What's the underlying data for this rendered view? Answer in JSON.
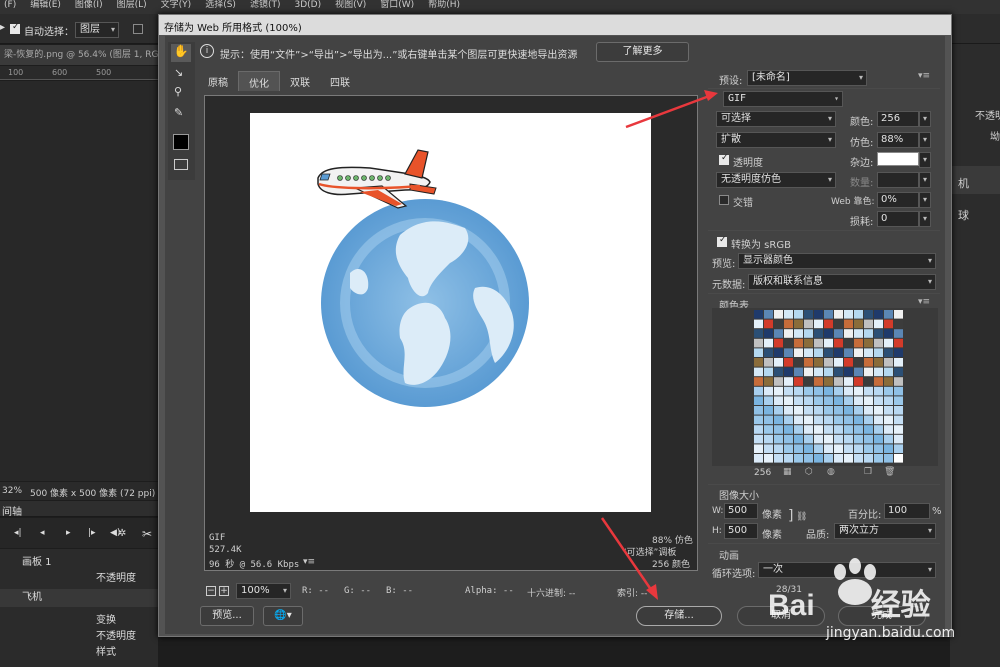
{
  "ps": {
    "menu": [
      "(F)",
      "编辑(E)",
      "图像(I)",
      "图层(L)",
      "文字(Y)",
      "选择(S)",
      "滤镜(T)",
      "3D(D)",
      "视图(V)",
      "窗口(W)",
      "帮助(H)"
    ],
    "auto_select": "自动选择：",
    "auto_select_value": "图层",
    "doc_tab": "梁-恢复的.png @ 56.4% (图层 1, RG",
    "ruler": [
      "100",
      "600",
      "500"
    ],
    "status_zoom": "32%",
    "status_info": "500 像素 x 500 像素 (72 ppi)",
    "timeline_title": "间轴",
    "layers": [
      {
        "name": "画板 1",
        "indent": 1
      },
      {
        "name": "不透明度",
        "indent": 2
      },
      {
        "name": "飞机",
        "indent": 1
      },
      {
        "name": "变换",
        "indent": 2
      },
      {
        "name": "不透明度",
        "indent": 2
      },
      {
        "name": "样式",
        "indent": 2
      }
    ],
    "right_items": [
      "不透明",
      "机",
      "球",
      "坳"
    ]
  },
  "dialog": {
    "title": "存储为 Web 所用格式 (100%)",
    "hint": "提示：使用“文件”>“导出”>“导出为...”或右键单击某个图层可更快速地导出资源",
    "learn_more": "了解更多",
    "tabs": [
      "原稿",
      "优化",
      "双联",
      "四联"
    ],
    "active_tab": "优化",
    "info_left": [
      "GIF",
      "527.4K",
      "96 秒 @ 56.6 Kbps"
    ],
    "info_right": [
      "88% 仿色",
      "“可选择”调板",
      "256 颜色"
    ],
    "zoom": "100%",
    "readout": {
      "r": "R: --",
      "g": "G: --",
      "b": "B: --",
      "alpha": "Alpha: --",
      "hex": "十六进制: --",
      "index": "索引: --"
    },
    "preview_btn": "预览...",
    "save_btn": "存储...",
    "cancel_btn": "取消",
    "done_btn": "完成"
  },
  "settings": {
    "preset_label": "预设:",
    "preset": "[未命名]",
    "format": "GIF",
    "reduction": "可选择",
    "colors_label": "颜色:",
    "colors": "256",
    "dither_algo": "扩散",
    "dither_label": "仿色:",
    "dither": "88%",
    "transparency": "透明度",
    "matte_label": "杂边:",
    "trans_dither": "无透明度仿色",
    "amount_label": "数量:",
    "interlaced": "交错",
    "websnap_label": "Web 靠色:",
    "websnap": "0%",
    "lossy_label": "损耗:",
    "lossy": "0",
    "convert_srgb": "转换为 sRGB",
    "preview_label": "预览:",
    "preview": "显示器颜色",
    "metadata_label": "元数据:",
    "metadata": "版权和联系信息",
    "color_table": "颜色表",
    "color_count": "256",
    "image_size": "图像大小",
    "w_label": "W:",
    "w": "500",
    "h_label": "H:",
    "h": "500",
    "px": "像素",
    "percent_label": "百分比:",
    "percent": "100",
    "pct": "%",
    "quality_label": "品质:",
    "quality": "两次立方",
    "animation": "动画",
    "loop_label": "循环选项:",
    "loop": "一次",
    "frame": "28/31"
  },
  "colors": {
    "dialog_bg": "#535353",
    "titlebar": "#dcdcdc",
    "arrow": "#e8383d"
  },
  "watermark": {
    "brand": "Bai",
    "brand2": "经验",
    "url": "jingyan.baidu.com"
  }
}
